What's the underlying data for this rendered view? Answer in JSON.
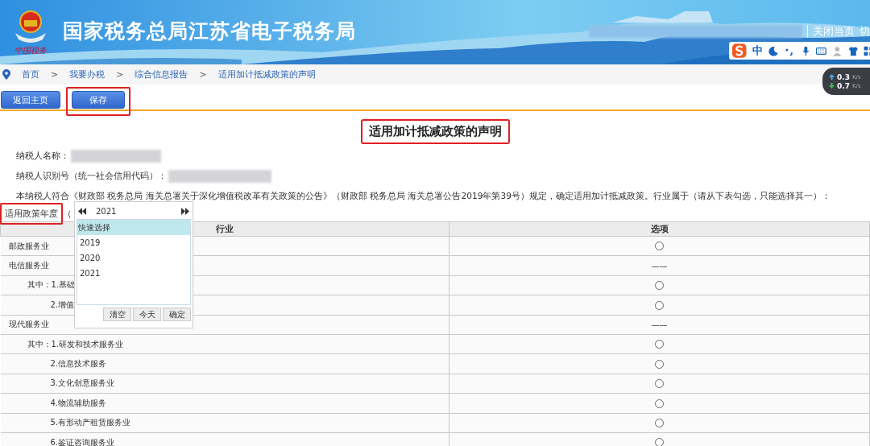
{
  "header": {
    "title": "国家税务总局江苏省电子税务局",
    "logo_caption": "中国税务",
    "links": [
      "关闭当页",
      "切"
    ]
  },
  "ime": {
    "mode": "中"
  },
  "speed": [
    {
      "kind": "up",
      "value": "0.3",
      "unit": "K/s"
    },
    {
      "kind": "down",
      "value": "0.7",
      "unit": "K/s"
    }
  ],
  "breadcrumb": [
    {
      "label": "首页"
    },
    {
      "separator": ">",
      "label": "我要办税"
    },
    {
      "separator": ">",
      "label": "综合信息报告"
    },
    {
      "separator": ">",
      "label": "适用加计抵减政策的声明"
    }
  ],
  "toolbar": [
    {
      "label": "返回主页",
      "highlighted": false
    },
    {
      "label": "保存",
      "highlighted": true
    }
  ],
  "form": {
    "title": {
      "text": "适用加计抵减政策的声明",
      "highlighted": true
    },
    "fields": [
      {
        "label": "纳税人名称："
      },
      {
        "label": "纳税人识别号（统一社会信用代码）："
      }
    ],
    "statement": "本纳税人符合《财政部 税务总局 海关总署关于深化增值税改革有关政策的公告》（财政部 税务总局 海关总署公告2019年第39号）规定，确定适用加计抵减政策。行业属于（请从下表勾选，只能选择其一）：",
    "year": {
      "label": "适用政策年度",
      "highlighted": true,
      "bracket": "（"
    }
  },
  "year_picker": {
    "year": "2021",
    "items": [
      {
        "label": "快速选择",
        "selected": true
      },
      {
        "label": "2019",
        "selected": false
      },
      {
        "label": "2020",
        "selected": false
      },
      {
        "label": "2021",
        "selected": false
      }
    ],
    "buttons": [
      "清空",
      "今天",
      "确定"
    ]
  },
  "table": {
    "columns": [
      "行业",
      "选项"
    ],
    "rows": [
      {
        "label": "邮政服务业",
        "kind": "radio",
        "checked": false
      },
      {
        "label": "电信服务业",
        "kind": "none",
        "dash": "——",
        "children": [
          {
            "label": "其中：1.基础",
            "kind": "radio",
            "checked": false
          },
          {
            "label": "2.增值",
            "kind": "radio",
            "checked": false
          }
        ]
      },
      {
        "label": "现代服务业",
        "kind": "none",
        "dash": "——",
        "children": [
          {
            "label": "其中：1.研发和技术服务业",
            "kind": "radio",
            "checked": false
          },
          {
            "label": "2.信息技术服务",
            "kind": "radio",
            "checked": false
          },
          {
            "label": "3.文化创意服务业",
            "kind": "radio",
            "checked": false
          },
          {
            "label": "4.物流辅助服务",
            "kind": "radio",
            "checked": false
          },
          {
            "label": "5.有形动产租赁服务业",
            "kind": "radio",
            "checked": false
          },
          {
            "label": "6.鉴证咨询服务业",
            "kind": "radio",
            "checked": false
          }
        ]
      }
    ]
  }
}
